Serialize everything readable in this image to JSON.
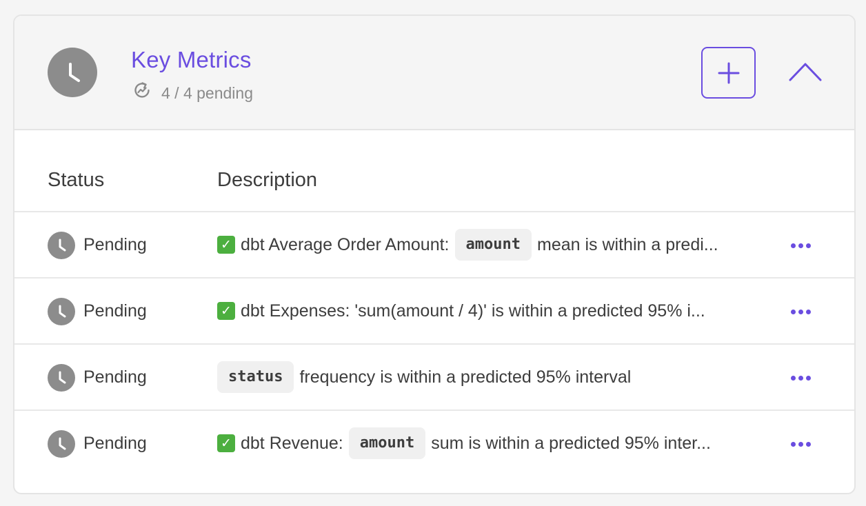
{
  "header": {
    "title": "Key Metrics",
    "subtitle": "4 / 4 pending"
  },
  "table": {
    "columns": {
      "status": "Status",
      "description": "Description"
    },
    "rows": [
      {
        "status": "Pending",
        "check": "✓",
        "prefix": "dbt Average Order Amount:",
        "code": "amount",
        "suffix": "mean is within a predi..."
      },
      {
        "status": "Pending",
        "check": "✓",
        "prefix": "dbt Expenses: 'sum(amount / 4)' is within a predicted 95% i..."
      },
      {
        "status": "Pending",
        "code": "status",
        "suffix": "frequency is within a predicted 95% interval"
      },
      {
        "status": "Pending",
        "check": "✓",
        "prefix": "dbt Revenue:",
        "code": "amount",
        "suffix": "sum is within a predicted 95% inter..."
      }
    ]
  },
  "colors": {
    "accent": "#6a4de0",
    "status_icon": "#8c8c8c",
    "check_green": "#4caf3f"
  }
}
